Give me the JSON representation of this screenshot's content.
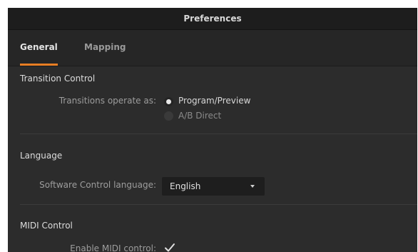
{
  "window": {
    "title": "Preferences"
  },
  "tabs": [
    {
      "label": "General",
      "active": true
    },
    {
      "label": "Mapping",
      "active": false
    }
  ],
  "transition_control": {
    "heading": "Transition Control",
    "label": "Transitions operate as:",
    "options": [
      {
        "label": "Program/Preview",
        "selected": true
      },
      {
        "label": "A/B Direct",
        "selected": false
      }
    ]
  },
  "language": {
    "heading": "Language",
    "label": "Software Control language:",
    "selected_value": "English"
  },
  "midi": {
    "heading": "MIDI Control",
    "label": "Enable MIDI control:",
    "checked": true
  },
  "colors": {
    "accent": "#e87e24",
    "background": "#2c2c2c",
    "titlebar": "#1d1d1d"
  },
  "icons": {
    "dropdown": "chevron-down-icon",
    "check": "checkmark-icon"
  }
}
